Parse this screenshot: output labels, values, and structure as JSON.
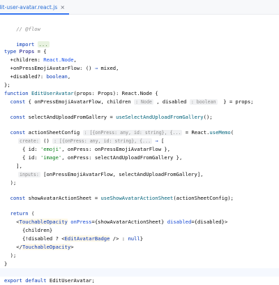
{
  "tab": {
    "filename": "edit-user-avatar.react.js",
    "filename_visible": "edit-user-avatar.react.js",
    "close_icon": "×"
  },
  "code": {
    "l1_flow": "// @flow",
    "l3_import": "import",
    "l3_fold": "...",
    "l5_type": "type",
    "l5_props": "Props",
    "l5_eq": " = {",
    "l6_children": "  +children: ",
    "l6_type": "React.Node",
    "l6_end": ",",
    "l7_prop": "  +onPressEmojiAvatarFlow: () ",
    "l7_arrow": "⇒",
    "l7_mixed": " mixed,",
    "l8_prop": "  +disabled?: ",
    "l8_type": "boolean",
    "l8_end": ",",
    "l9": "};",
    "l10_function": "function",
    "l10_name": " EditUserAvatar",
    "l10_rest": "(props: Props): React.Node {",
    "l11_const": "  const",
    "l11_a": " { onPressEmojiAvatarFlow, children ",
    "l11_hint1": ": Node",
    "l11_b": " , disabled ",
    "l11_hint2": ": boolean",
    "l11_c": "  } = props;",
    "l13_const": "  const",
    "l13_name": " selectAndUploadFromGallery = ",
    "l13_fn": "useSelectAndUploadFromGallery",
    "l13_end": "();",
    "l15_const": "  const",
    "l15_name": " actionSheetConfig ",
    "l15_hint": ": [{onPress: any, id: string}, {...",
    "l15_eq": " = React.",
    "l15_memo": "useMemo",
    "l15_end": "(",
    "l16_hint": "create:",
    "l16_a": " () ",
    "l16_hint2": ": [{onPress: any, id: string}, {...",
    "l16_arrow": " ⇒",
    "l16_end": " [",
    "l17_a": "      { id: ",
    "l17_str": "'emoji'",
    "l17_b": ", onPress: onPressEmojiAvatarFlow },",
    "l18_a": "      { id: ",
    "l18_str": "'image'",
    "l18_b": ", onPress: selectAndUploadFromGallery },",
    "l19": "    ],",
    "l20_hint": "inputs:",
    "l20_a": " [onPressEmojiAvatarFlow, selectAndUploadFromGallery],",
    "l21": "  );",
    "l23_const": "  const",
    "l23_name": " showAvatarActionSheet = ",
    "l23_fn": "useShowAvatarActionSheet",
    "l23_end": "(actionSheetConfig);",
    "l25_return": "  return",
    "l25_end": " (",
    "l26_open": "    <",
    "l26_tag": "TouchableOpacity",
    "l26_attr1": " onPress",
    "l26_val1": "={showAvatarActionSheet}",
    "l26_attr2": " disabled",
    "l26_val2": "={disabled}",
    "l26_close": ">",
    "l27": "      {children}",
    "l28_a": "      {!disabled ? <",
    "l28_tag": "EditAvatarBadge",
    "l28_b": " /> : ",
    "l28_null": "null",
    "l28_c": "}",
    "l29_open": "    </",
    "l29_tag": "TouchableOpacity",
    "l29_close": ">",
    "l30": "  );",
    "l31": "}",
    "l33_export": "export",
    "l33_default": " default",
    "l33_name": " EditUserAvatar;"
  }
}
